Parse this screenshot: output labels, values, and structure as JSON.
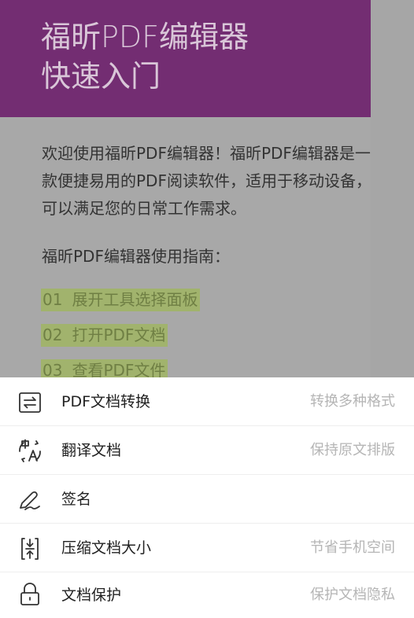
{
  "document": {
    "title_line1": "福昕PDF编辑器",
    "title_line2": "快速入门",
    "intro": "欢迎使用福昕PDF编辑器！福昕PDF编辑器是一款便捷易用的PDF阅读软件，适用于移动设备，可以满足您的日常工作需求。",
    "guide_title": "福昕PDF编辑器使用指南：",
    "steps": [
      {
        "num": "01",
        "text": "展开工具选择面板"
      },
      {
        "num": "02",
        "text": "打开PDF文档"
      },
      {
        "num": "03",
        "text": "查看PDF文件"
      }
    ]
  },
  "menu": {
    "items": [
      {
        "icon": "convert-arrows-icon",
        "label": "PDF文档转换",
        "desc": "转换多种格式"
      },
      {
        "icon": "translate-icon",
        "label": "翻译文档",
        "desc": "保持原文排版"
      },
      {
        "icon": "signature-icon",
        "label": "签名",
        "desc": ""
      },
      {
        "icon": "compress-icon",
        "label": "压缩文档大小",
        "desc": "节省手机空间"
      },
      {
        "icon": "lock-icon",
        "label": "文档保护",
        "desc": "保护文档隐私"
      }
    ]
  },
  "colors": {
    "banner": "#732d72",
    "highlight": "#a1b36d",
    "overlay": "#a6a6a6",
    "sheet": "#ffffff"
  }
}
